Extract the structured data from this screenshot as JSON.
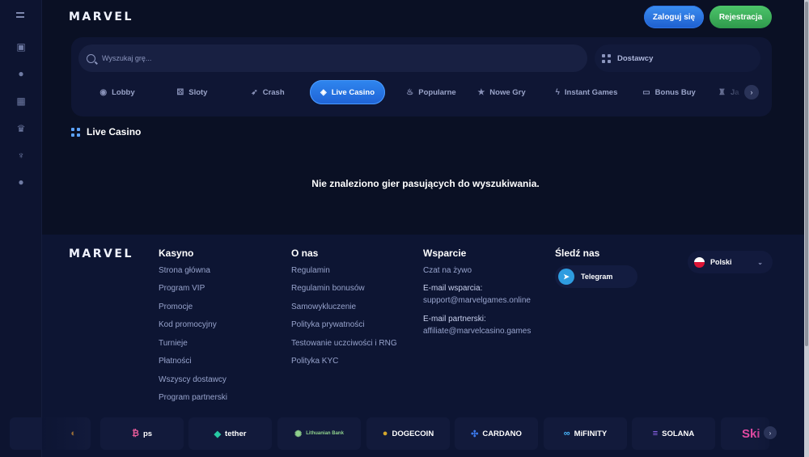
{
  "header": {
    "logo": "MARVEL",
    "login_label": "Zaloguj się",
    "register_label": "Rejestracja"
  },
  "search": {
    "placeholder": "Wyszukaj grę...",
    "providers_label": "Dostawcy"
  },
  "tabs": [
    {
      "label": "Lobby",
      "icon": "gamepad-icon"
    },
    {
      "label": "Sloty",
      "icon": "slot-machine-icon"
    },
    {
      "label": "Crash",
      "icon": "rocket-icon"
    },
    {
      "label": "Live Casino",
      "icon": "live-dealer-icon",
      "active": true
    },
    {
      "label": "Popularne",
      "icon": "fire-icon"
    },
    {
      "label": "Nowe Gry",
      "icon": "star-icon"
    },
    {
      "label": "Instant Games",
      "icon": "lightning-icon"
    },
    {
      "label": "Bonus Buy",
      "icon": "ticket-icon"
    },
    {
      "label": "Ja",
      "icon": "jackpot-icon"
    }
  ],
  "section": {
    "title": "Live Casino",
    "empty_message": "Nie znaleziono gier pasujących do wyszukiwania."
  },
  "footer": {
    "logo": "MARVEL",
    "kasyno": {
      "title": "Kasyno",
      "links": [
        "Strona główna",
        "Program VIP",
        "Promocje",
        "Kod promocyjny",
        "Turnieje",
        "Płatności",
        "Wszyscy dostawcy",
        "Program partnerski"
      ]
    },
    "o_nas": {
      "title": "O nas",
      "links": [
        "Regulamin",
        "Regulamin bonusów",
        "Samowykluczenie",
        "Polityka prywatności",
        "Testowanie uczciwości i RNG",
        "Polityka KYC"
      ]
    },
    "wsparcie": {
      "title": "Wsparcie",
      "chat": "Czat na żywo",
      "support_label": "E-mail wsparcia:",
      "support_email": "support@marvelgames.online",
      "partner_label": "E-mail partnerski:",
      "partner_email": "affiliate@marvelcasino.games"
    },
    "social": {
      "title": "Śledź nas",
      "telegram": "Telegram"
    },
    "language": "Polski"
  },
  "payments": [
    "ps",
    "tether",
    "Lithuanian Bank",
    "DOGECOIN",
    "CARDANO",
    "MiFINITY",
    "SOLANA",
    "Ski"
  ],
  "colors": {
    "accent_blue": "#2f86ef",
    "register_green": "#3fb45c",
    "background": "#0a1024"
  }
}
